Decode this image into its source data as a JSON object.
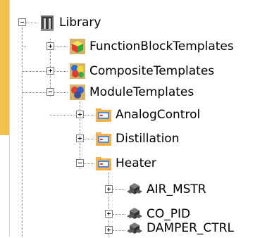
{
  "tree": {
    "root": {
      "label": "Library",
      "icon": "library-icon",
      "expanded": true
    },
    "level1": [
      {
        "label": "FunctionBlockTemplates",
        "icon": "function-block-templates-icon",
        "expanded": false
      },
      {
        "label": "CompositeTemplates",
        "icon": "composite-templates-icon",
        "expanded": false
      },
      {
        "label": "ModuleTemplates",
        "icon": "module-templates-icon",
        "expanded": true
      }
    ],
    "level2": [
      {
        "label": "AnalogControl",
        "icon": "folder-icon",
        "expanded": false
      },
      {
        "label": "Distillation",
        "icon": "folder-icon",
        "expanded": false
      },
      {
        "label": "Heater",
        "icon": "folder-icon",
        "expanded": true
      }
    ],
    "level3": [
      {
        "label": "AIR_MSTR",
        "icon": "module-icon",
        "expanded": false
      },
      {
        "label": "CO_PID",
        "icon": "module-icon",
        "expanded": false
      },
      {
        "label": "DAMPER_CTRL",
        "icon": "module-icon",
        "expanded": false
      }
    ]
  },
  "colors": {
    "accent": "#f3c14b",
    "guide": "#8a8a8a"
  }
}
